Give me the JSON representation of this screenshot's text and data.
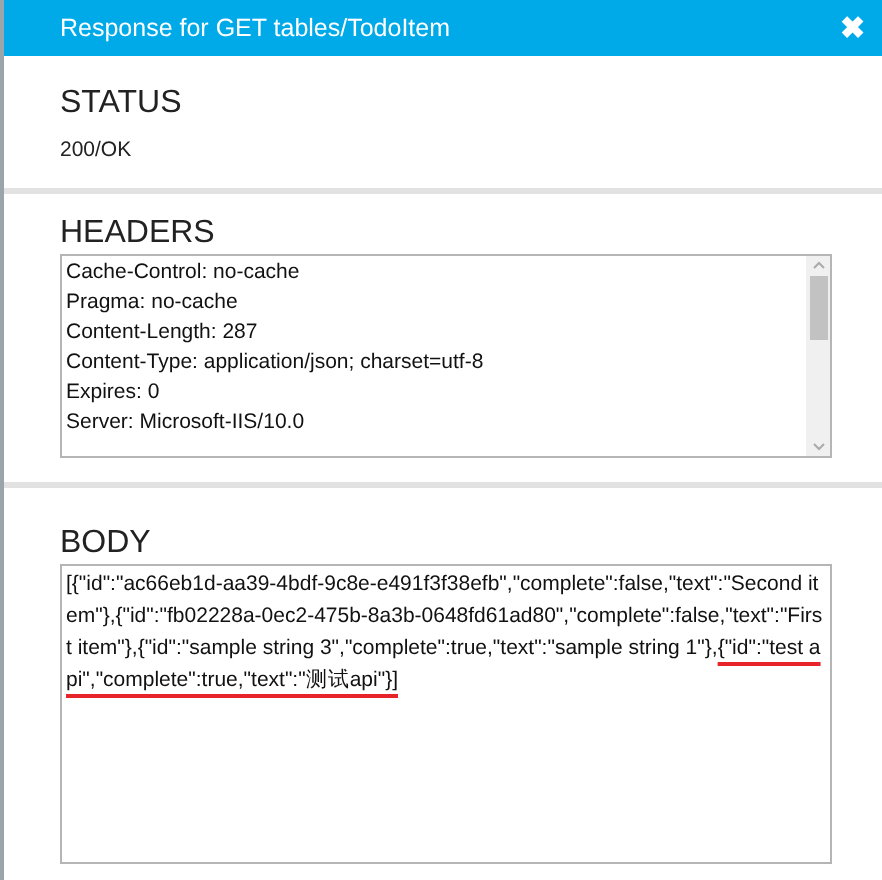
{
  "window": {
    "title": "Response for GET tables/TodoItem",
    "close": "✖"
  },
  "status": {
    "heading": "STATUS",
    "value": "200/OK"
  },
  "headers": {
    "heading": "HEADERS",
    "lines": [
      "Cache-Control: no-cache",
      "Pragma: no-cache",
      "Content-Length: 287",
      "Content-Type: application/json; charset=utf-8",
      "Expires: 0",
      "Server: Microsoft-IIS/10.0"
    ]
  },
  "body": {
    "heading": "BODY",
    "text": "[{\"id\":\"ac66eb1d-aa39-4bdf-9c8e-e491f3f38efb\",\"complete\":false,\"text\":\"Second item\"},{\"id\":\"fb02228a-0ec2-475b-8a3b-0648fd61ad80\",\"complete\":false,\"text\":\"First item\"},{\"id\":\"sample string 3\",\"complete\":true,\"text\":\"sample string 1\"},",
    "highlighted": "{\"id\":\"test api\",\"complete\":true,\"text\":\"测试api\"}]"
  }
}
